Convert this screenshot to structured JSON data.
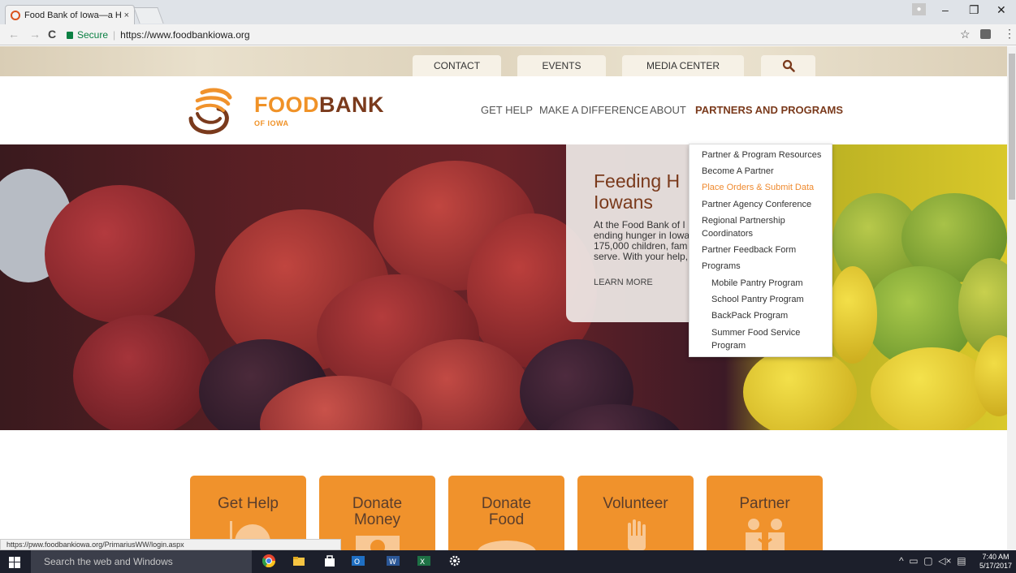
{
  "browser": {
    "tab_title": "Food Bank of Iowa—a H",
    "tab_close": "×",
    "secure_label": "Secure",
    "url": "https://www.foodbankiowa.org",
    "status_url": "https://pww.foodbankiowa.org/PrimariusWW/login.aspx"
  },
  "utility_nav": [
    "CONTACT",
    "EVENTS",
    "MEDIA CENTER"
  ],
  "logo": {
    "food": "FOOD",
    "bank": "BANK",
    "sub": "OF IOWA"
  },
  "main_nav": [
    "GET HELP",
    "MAKE A DIFFERENCE",
    "ABOUT",
    "PARTNERS AND PROGRAMS"
  ],
  "hero": {
    "title_line1": "Feeding H",
    "title_line2": "Iowans",
    "body_lines": [
      "At the Food Bank of I",
      "ending hunger in Iowa",
      "175,000 children, fam",
      "serve. With your help,"
    ],
    "learn_more": "LEARN MORE"
  },
  "dropdown": [
    {
      "label": "Partner & Program Resources"
    },
    {
      "label": "Become A Partner"
    },
    {
      "label": "Place Orders & Submit Data"
    },
    {
      "label": "Partner Agency Conference"
    },
    {
      "label": "Regional Partnership Coordinators"
    },
    {
      "label": "Partner Feedback Form"
    },
    {
      "label": "Programs"
    },
    {
      "label": "Mobile Pantry Program"
    },
    {
      "label": "School Pantry Program"
    },
    {
      "label": "BackPack Program"
    },
    {
      "label": "Summer Food Service Program"
    }
  ],
  "tiles": [
    {
      "line1": "Get Help",
      "line2": ""
    },
    {
      "line1": "Donate",
      "line2": "Money"
    },
    {
      "line1": "Donate",
      "line2": "Food"
    },
    {
      "line1": "Volunteer",
      "line2": ""
    },
    {
      "line1": "Partner",
      "line2": ""
    }
  ],
  "taskbar": {
    "search_placeholder": "Search the web and Windows",
    "time": "7:40 AM",
    "date": "5/17/2017"
  },
  "colors": {
    "brand_orange": "#f0922c",
    "brand_brown": "#7a3a1c",
    "dropdown_highlight": "#ef8a2f",
    "secure_green": "#0b8043"
  }
}
